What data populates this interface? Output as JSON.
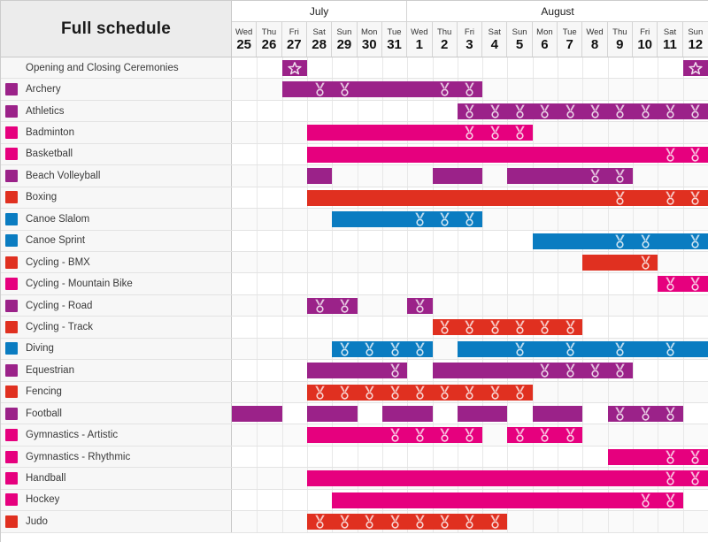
{
  "header": {
    "title": "Full schedule",
    "months": [
      {
        "name": "July",
        "days": 7
      },
      {
        "name": "August",
        "days": 12
      }
    ],
    "days": [
      {
        "dow": "Wed",
        "num": "25",
        "month": "July"
      },
      {
        "dow": "Thu",
        "num": "26",
        "month": "July"
      },
      {
        "dow": "Fri",
        "num": "27",
        "month": "July"
      },
      {
        "dow": "Sat",
        "num": "28",
        "month": "July"
      },
      {
        "dow": "Sun",
        "num": "29",
        "month": "July"
      },
      {
        "dow": "Mon",
        "num": "30",
        "month": "July"
      },
      {
        "dow": "Tue",
        "num": "31",
        "month": "July"
      },
      {
        "dow": "Wed",
        "num": "1",
        "month": "August"
      },
      {
        "dow": "Thu",
        "num": "2",
        "month": "August"
      },
      {
        "dow": "Fri",
        "num": "3",
        "month": "August"
      },
      {
        "dow": "Sat",
        "num": "4",
        "month": "August"
      },
      {
        "dow": "Sun",
        "num": "5",
        "month": "August"
      },
      {
        "dow": "Mon",
        "num": "6",
        "month": "August"
      },
      {
        "dow": "Tue",
        "num": "7",
        "month": "August"
      },
      {
        "dow": "Wed",
        "num": "8",
        "month": "August"
      },
      {
        "dow": "Thu",
        "num": "9",
        "month": "August"
      },
      {
        "dow": "Fri",
        "num": "10",
        "month": "August"
      },
      {
        "dow": "Sat",
        "num": "11",
        "month": "August"
      },
      {
        "dow": "Sun",
        "num": "12",
        "month": "August"
      }
    ]
  },
  "colors": {
    "purple": "#9B2289",
    "magenta": "#E6007E",
    "blue": "#0A7CC1",
    "red": "#E03020",
    "header_bg": "#ececec",
    "row_bg": "#f7f7f7",
    "grid_line": "#e8e8e8"
  },
  "chart_data": {
    "type": "gantt",
    "title": "Full schedule",
    "xlabel": "",
    "ylabel": "",
    "x_categories": [
      "Jul 25",
      "Jul 26",
      "Jul 27",
      "Jul 28",
      "Jul 29",
      "Jul 30",
      "Jul 31",
      "Aug 1",
      "Aug 2",
      "Aug 3",
      "Aug 4",
      "Aug 5",
      "Aug 6",
      "Aug 7",
      "Aug 8",
      "Aug 9",
      "Aug 10",
      "Aug 11",
      "Aug 12"
    ],
    "legend": [],
    "grid": true,
    "rows": [
      {
        "label": "Opening and Closing Ceremonies",
        "color": "#9B2289",
        "swatch": false,
        "bars": [
          {
            "start": 2,
            "end": 2,
            "icon": "star",
            "medals": []
          },
          {
            "start": 18,
            "end": 18,
            "icon": "star",
            "medals": []
          }
        ]
      },
      {
        "label": "Archery",
        "color": "#9B2289",
        "swatch": true,
        "bars": [
          {
            "start": 2,
            "end": 9,
            "medals": [
              3,
              4,
              8,
              9
            ]
          }
        ]
      },
      {
        "label": "Athletics",
        "color": "#9B2289",
        "swatch": true,
        "bars": [
          {
            "start": 9,
            "end": 18,
            "medals": [
              9,
              10,
              11,
              12,
              13,
              14,
              15,
              16,
              17,
              18
            ]
          }
        ]
      },
      {
        "label": "Badminton",
        "color": "#E6007E",
        "swatch": true,
        "bars": [
          {
            "start": 3,
            "end": 11,
            "medals": [
              9,
              10,
              11
            ]
          }
        ]
      },
      {
        "label": "Basketball",
        "color": "#E6007E",
        "swatch": true,
        "bars": [
          {
            "start": 3,
            "end": 18,
            "medals": [
              17,
              18
            ]
          }
        ]
      },
      {
        "label": "Beach Volleyball",
        "color": "#9B2289",
        "swatch": true,
        "bars": [
          {
            "start": 3,
            "end": 3,
            "medals": []
          },
          {
            "start": 8,
            "end": 9,
            "medals": []
          },
          {
            "start": 11,
            "end": 15,
            "medals": [
              14,
              15
            ]
          }
        ]
      },
      {
        "label": "Boxing",
        "color": "#E03020",
        "swatch": true,
        "bars": [
          {
            "start": 3,
            "end": 18,
            "medals": [
              15,
              17,
              18
            ]
          }
        ]
      },
      {
        "label": "Canoe Slalom",
        "color": "#0A7CC1",
        "swatch": true,
        "bars": [
          {
            "start": 4,
            "end": 9,
            "medals": [
              7,
              8,
              9
            ]
          }
        ]
      },
      {
        "label": "Canoe Sprint",
        "color": "#0A7CC1",
        "swatch": true,
        "bars": [
          {
            "start": 12,
            "end": 18,
            "medals": [
              15,
              16,
              18
            ]
          }
        ]
      },
      {
        "label": "Cycling - BMX",
        "color": "#E03020",
        "swatch": true,
        "bars": [
          {
            "start": 14,
            "end": 16,
            "medals": [
              16
            ]
          }
        ]
      },
      {
        "label": "Cycling - Mountain Bike",
        "color": "#E6007E",
        "swatch": true,
        "bars": [
          {
            "start": 17,
            "end": 18,
            "medals": [
              17,
              18
            ]
          }
        ]
      },
      {
        "label": "Cycling - Road",
        "color": "#9B2289",
        "swatch": true,
        "bars": [
          {
            "start": 3,
            "end": 4,
            "medals": [
              3,
              4
            ]
          },
          {
            "start": 7,
            "end": 7,
            "medals": [
              7
            ]
          }
        ]
      },
      {
        "label": "Cycling - Track",
        "color": "#E03020",
        "swatch": true,
        "bars": [
          {
            "start": 8,
            "end": 13,
            "medals": [
              8,
              9,
              10,
              11,
              12,
              13
            ]
          }
        ]
      },
      {
        "label": "Diving",
        "color": "#0A7CC1",
        "swatch": true,
        "bars": [
          {
            "start": 4,
            "end": 7,
            "medals": [
              4,
              5,
              6,
              7
            ]
          },
          {
            "start": 9,
            "end": 18,
            "medals": [
              11,
              13,
              15,
              17
            ]
          }
        ]
      },
      {
        "label": "Equestrian",
        "color": "#9B2289",
        "swatch": true,
        "bars": [
          {
            "start": 3,
            "end": 6,
            "medals": [
              6
            ]
          },
          {
            "start": 8,
            "end": 15,
            "medals": [
              12,
              13,
              14,
              15
            ]
          }
        ]
      },
      {
        "label": "Fencing",
        "color": "#E03020",
        "swatch": true,
        "bars": [
          {
            "start": 3,
            "end": 11,
            "medals": [
              3,
              4,
              5,
              6,
              7,
              8,
              9,
              10,
              11
            ]
          }
        ]
      },
      {
        "label": "Football",
        "color": "#9B2289",
        "swatch": true,
        "bars": [
          {
            "start": 0,
            "end": 1,
            "medals": []
          },
          {
            "start": 3,
            "end": 4,
            "medals": []
          },
          {
            "start": 6,
            "end": 7,
            "medals": []
          },
          {
            "start": 9,
            "end": 10,
            "medals": []
          },
          {
            "start": 12,
            "end": 13,
            "medals": []
          },
          {
            "start": 15,
            "end": 17,
            "medals": [
              15,
              16,
              17
            ]
          }
        ]
      },
      {
        "label": "Gymnastics - Artistic",
        "color": "#E6007E",
        "swatch": true,
        "bars": [
          {
            "start": 3,
            "end": 9,
            "medals": [
              6,
              7,
              8,
              9
            ]
          },
          {
            "start": 11,
            "end": 13,
            "medals": [
              11,
              12,
              13
            ]
          }
        ]
      },
      {
        "label": "Gymnastics - Rhythmic",
        "color": "#E6007E",
        "swatch": true,
        "bars": [
          {
            "start": 15,
            "end": 18,
            "medals": [
              17,
              18
            ]
          }
        ]
      },
      {
        "label": "Handball",
        "color": "#E6007E",
        "swatch": true,
        "bars": [
          {
            "start": 3,
            "end": 18,
            "medals": [
              17,
              18
            ]
          }
        ]
      },
      {
        "label": "Hockey",
        "color": "#E6007E",
        "swatch": true,
        "bars": [
          {
            "start": 4,
            "end": 17,
            "medals": [
              16,
              17
            ]
          }
        ]
      },
      {
        "label": "Judo",
        "color": "#E03020",
        "swatch": true,
        "bars": [
          {
            "start": 3,
            "end": 10,
            "medals": [
              3,
              4,
              5,
              6,
              7,
              8,
              9,
              10
            ]
          }
        ]
      }
    ]
  }
}
